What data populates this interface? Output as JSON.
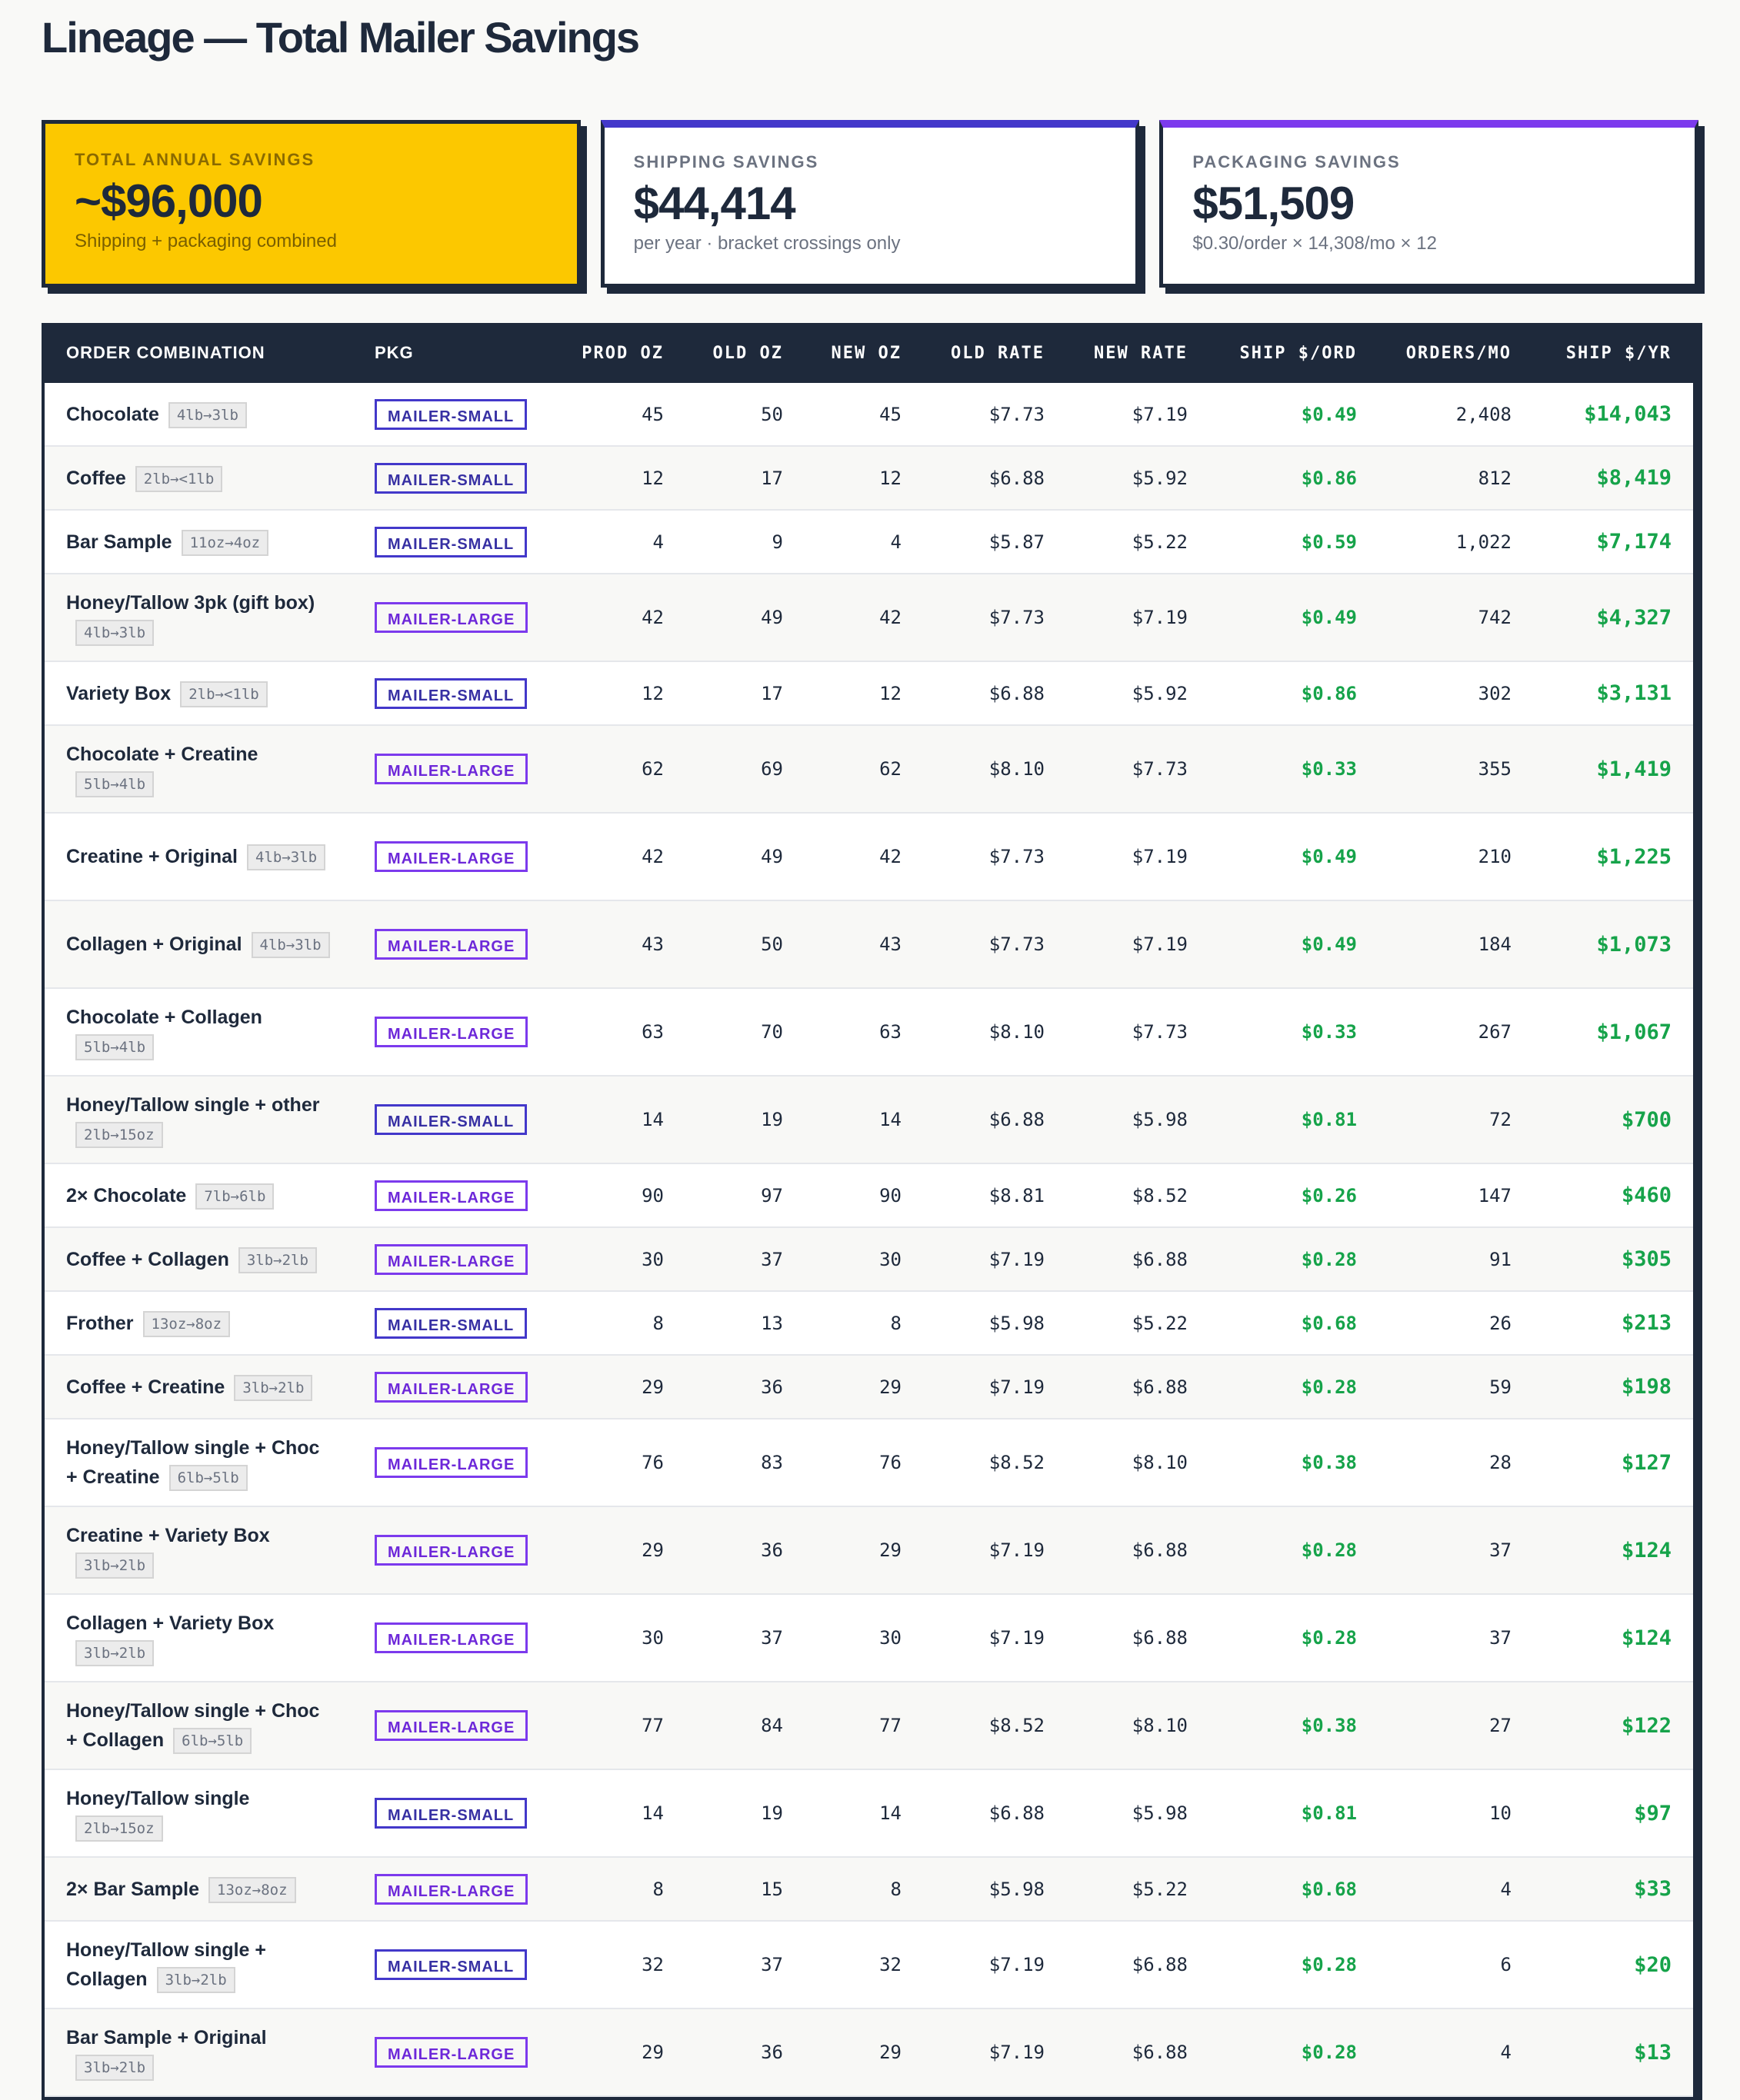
{
  "page_title": "Lineage — Total Mailer Savings",
  "cards": {
    "total": {
      "label": "TOTAL ANNUAL SAVINGS",
      "value": "~$96,000",
      "sub": "Shipping + packaging combined"
    },
    "shipping": {
      "label": "SHIPPING SAVINGS",
      "value": "$44,414",
      "sub": "per year · bracket crossings only"
    },
    "packaging": {
      "label": "PACKAGING SAVINGS",
      "value": "$51,509",
      "sub": "$0.30/order × 14,308/mo × 12"
    }
  },
  "colors": {
    "accent_yellow": "#fcc800",
    "navy": "#1e293b",
    "indigo": "#4338ca",
    "purple": "#7c3aed",
    "green": "#16a34a"
  },
  "table": {
    "headers": {
      "combo": "ORDER COMBINATION",
      "pkg": "PKG",
      "prod_oz": "PROD OZ",
      "old_oz": "OLD OZ",
      "new_oz": "NEW OZ",
      "old_rate": "OLD RATE",
      "new_rate": "NEW RATE",
      "ship_ord": "SHIP $/ORD",
      "orders_mo": "ORDERS/MO",
      "ship_yr": "SHIP $/YR"
    },
    "rows": [
      {
        "name": "Chocolate",
        "tag": "4lb→3lb",
        "pkg": "MAILER-SMALL",
        "prod_oz": "45",
        "old_oz": "50",
        "new_oz": "45",
        "old_rate": "$7.73",
        "new_rate": "$7.19",
        "ship_ord": "$0.49",
        "orders_mo": "2,408",
        "ship_yr": "$14,043"
      },
      {
        "name": "Coffee",
        "tag": "2lb→<1lb",
        "pkg": "MAILER-SMALL",
        "prod_oz": "12",
        "old_oz": "17",
        "new_oz": "12",
        "old_rate": "$6.88",
        "new_rate": "$5.92",
        "ship_ord": "$0.86",
        "orders_mo": "812",
        "ship_yr": "$8,419"
      },
      {
        "name": "Bar Sample",
        "tag": "11oz→4oz",
        "pkg": "MAILER-SMALL",
        "prod_oz": "4",
        "old_oz": "9",
        "new_oz": "4",
        "old_rate": "$5.87",
        "new_rate": "$5.22",
        "ship_ord": "$0.59",
        "orders_mo": "1,022",
        "ship_yr": "$7,174"
      },
      {
        "name": "Honey/Tallow 3pk (gift box)",
        "tag": "4lb→3lb",
        "pkg": "MAILER-LARGE",
        "prod_oz": "42",
        "old_oz": "49",
        "new_oz": "42",
        "old_rate": "$7.73",
        "new_rate": "$7.19",
        "ship_ord": "$0.49",
        "orders_mo": "742",
        "ship_yr": "$4,327"
      },
      {
        "name": "Variety Box",
        "tag": "2lb→<1lb",
        "pkg": "MAILER-SMALL",
        "prod_oz": "12",
        "old_oz": "17",
        "new_oz": "12",
        "old_rate": "$6.88",
        "new_rate": "$5.92",
        "ship_ord": "$0.86",
        "orders_mo": "302",
        "ship_yr": "$3,131"
      },
      {
        "name": "Chocolate + Creatine",
        "tag": "5lb→4lb",
        "pkg": "MAILER-LARGE",
        "prod_oz": "62",
        "old_oz": "69",
        "new_oz": "62",
        "old_rate": "$8.10",
        "new_rate": "$7.73",
        "ship_ord": "$0.33",
        "orders_mo": "355",
        "ship_yr": "$1,419"
      },
      {
        "name": "Creatine + Original",
        "tag": "4lb→3lb",
        "pkg": "MAILER-LARGE",
        "prod_oz": "42",
        "old_oz": "49",
        "new_oz": "42",
        "old_rate": "$7.73",
        "new_rate": "$7.19",
        "ship_ord": "$0.49",
        "orders_mo": "210",
        "ship_yr": "$1,225"
      },
      {
        "name": "Collagen + Original",
        "tag": "4lb→3lb",
        "pkg": "MAILER-LARGE",
        "prod_oz": "43",
        "old_oz": "50",
        "new_oz": "43",
        "old_rate": "$7.73",
        "new_rate": "$7.19",
        "ship_ord": "$0.49",
        "orders_mo": "184",
        "ship_yr": "$1,073"
      },
      {
        "name": "Chocolate + Collagen",
        "tag": "5lb→4lb",
        "pkg": "MAILER-LARGE",
        "prod_oz": "63",
        "old_oz": "70",
        "new_oz": "63",
        "old_rate": "$8.10",
        "new_rate": "$7.73",
        "ship_ord": "$0.33",
        "orders_mo": "267",
        "ship_yr": "$1,067"
      },
      {
        "name": "Honey/Tallow single + other",
        "tag": "2lb→15oz",
        "pkg": "MAILER-SMALL",
        "prod_oz": "14",
        "old_oz": "19",
        "new_oz": "14",
        "old_rate": "$6.88",
        "new_rate": "$5.98",
        "ship_ord": "$0.81",
        "orders_mo": "72",
        "ship_yr": "$700"
      },
      {
        "name": "2× Chocolate",
        "tag": "7lb→6lb",
        "pkg": "MAILER-LARGE",
        "prod_oz": "90",
        "old_oz": "97",
        "new_oz": "90",
        "old_rate": "$8.81",
        "new_rate": "$8.52",
        "ship_ord": "$0.26",
        "orders_mo": "147",
        "ship_yr": "$460"
      },
      {
        "name": "Coffee + Collagen",
        "tag": "3lb→2lb",
        "pkg": "MAILER-LARGE",
        "prod_oz": "30",
        "old_oz": "37",
        "new_oz": "30",
        "old_rate": "$7.19",
        "new_rate": "$6.88",
        "ship_ord": "$0.28",
        "orders_mo": "91",
        "ship_yr": "$305"
      },
      {
        "name": "Frother",
        "tag": "13oz→8oz",
        "pkg": "MAILER-SMALL",
        "prod_oz": "8",
        "old_oz": "13",
        "new_oz": "8",
        "old_rate": "$5.98",
        "new_rate": "$5.22",
        "ship_ord": "$0.68",
        "orders_mo": "26",
        "ship_yr": "$213"
      },
      {
        "name": "Coffee + Creatine",
        "tag": "3lb→2lb",
        "pkg": "MAILER-LARGE",
        "prod_oz": "29",
        "old_oz": "36",
        "new_oz": "29",
        "old_rate": "$7.19",
        "new_rate": "$6.88",
        "ship_ord": "$0.28",
        "orders_mo": "59",
        "ship_yr": "$198"
      },
      {
        "name": "Honey/Tallow single + Choc + Creatine",
        "tag": "6lb→5lb",
        "pkg": "MAILER-LARGE",
        "prod_oz": "76",
        "old_oz": "83",
        "new_oz": "76",
        "old_rate": "$8.52",
        "new_rate": "$8.10",
        "ship_ord": "$0.38",
        "orders_mo": "28",
        "ship_yr": "$127"
      },
      {
        "name": "Creatine + Variety Box",
        "tag": "3lb→2lb",
        "pkg": "MAILER-LARGE",
        "prod_oz": "29",
        "old_oz": "36",
        "new_oz": "29",
        "old_rate": "$7.19",
        "new_rate": "$6.88",
        "ship_ord": "$0.28",
        "orders_mo": "37",
        "ship_yr": "$124"
      },
      {
        "name": "Collagen + Variety Box",
        "tag": "3lb→2lb",
        "pkg": "MAILER-LARGE",
        "prod_oz": "30",
        "old_oz": "37",
        "new_oz": "30",
        "old_rate": "$7.19",
        "new_rate": "$6.88",
        "ship_ord": "$0.28",
        "orders_mo": "37",
        "ship_yr": "$124"
      },
      {
        "name": "Honey/Tallow single + Choc + Collagen",
        "tag": "6lb→5lb",
        "pkg": "MAILER-LARGE",
        "prod_oz": "77",
        "old_oz": "84",
        "new_oz": "77",
        "old_rate": "$8.52",
        "new_rate": "$8.10",
        "ship_ord": "$0.38",
        "orders_mo": "27",
        "ship_yr": "$122"
      },
      {
        "name": "Honey/Tallow single",
        "tag": "2lb→15oz",
        "pkg": "MAILER-SMALL",
        "prod_oz": "14",
        "old_oz": "19",
        "new_oz": "14",
        "old_rate": "$6.88",
        "new_rate": "$5.98",
        "ship_ord": "$0.81",
        "orders_mo": "10",
        "ship_yr": "$97"
      },
      {
        "name": "2× Bar Sample",
        "tag": "13oz→8oz",
        "pkg": "MAILER-LARGE",
        "prod_oz": "8",
        "old_oz": "15",
        "new_oz": "8",
        "old_rate": "$5.98",
        "new_rate": "$5.22",
        "ship_ord": "$0.68",
        "orders_mo": "4",
        "ship_yr": "$33"
      },
      {
        "name": "Honey/Tallow single + Collagen",
        "tag": "3lb→2lb",
        "pkg": "MAILER-SMALL",
        "prod_oz": "32",
        "old_oz": "37",
        "new_oz": "32",
        "old_rate": "$7.19",
        "new_rate": "$6.88",
        "ship_ord": "$0.28",
        "orders_mo": "6",
        "ship_yr": "$20"
      },
      {
        "name": "Bar Sample + Original",
        "tag": "3lb→2lb",
        "pkg": "MAILER-LARGE",
        "prod_oz": "29",
        "old_oz": "36",
        "new_oz": "29",
        "old_rate": "$7.19",
        "new_rate": "$6.88",
        "ship_ord": "$0.28",
        "orders_mo": "4",
        "ship_yr": "$13"
      }
    ]
  }
}
